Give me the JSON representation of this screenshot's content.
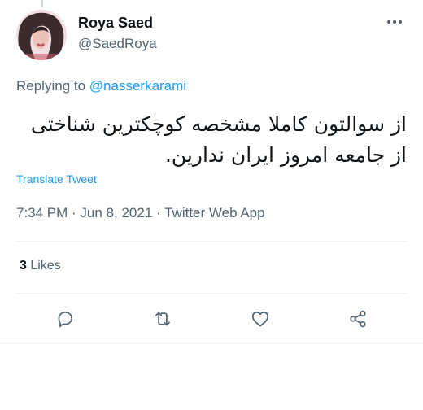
{
  "tweet": {
    "author": {
      "name": "Roya Saed",
      "handle": "@SaedRoya"
    },
    "reply": {
      "prefix": "Replying to ",
      "mention": "@nasserkarami"
    },
    "text_line1": "از سوالتون کاملا مشخصه کوچکترین شناختی",
    "text_line2": "از جامعه امروز ایران ندارین.",
    "translate_label": "Translate Tweet",
    "time": "7:34 PM",
    "date": "Jun 8, 2021",
    "separator": " · ",
    "app": "Twitter Web App",
    "likes_count": "3",
    "likes_label": " Likes"
  },
  "icons": {
    "more": "more-horizontal-icon",
    "reply": "reply-icon",
    "retweet": "retweet-icon",
    "like": "heart-icon",
    "share": "share-icon"
  },
  "colors": {
    "accent": "#1d9bf0",
    "secondary_text": "#536471",
    "primary_text": "#0f1419",
    "divider": "#eff3f4"
  }
}
